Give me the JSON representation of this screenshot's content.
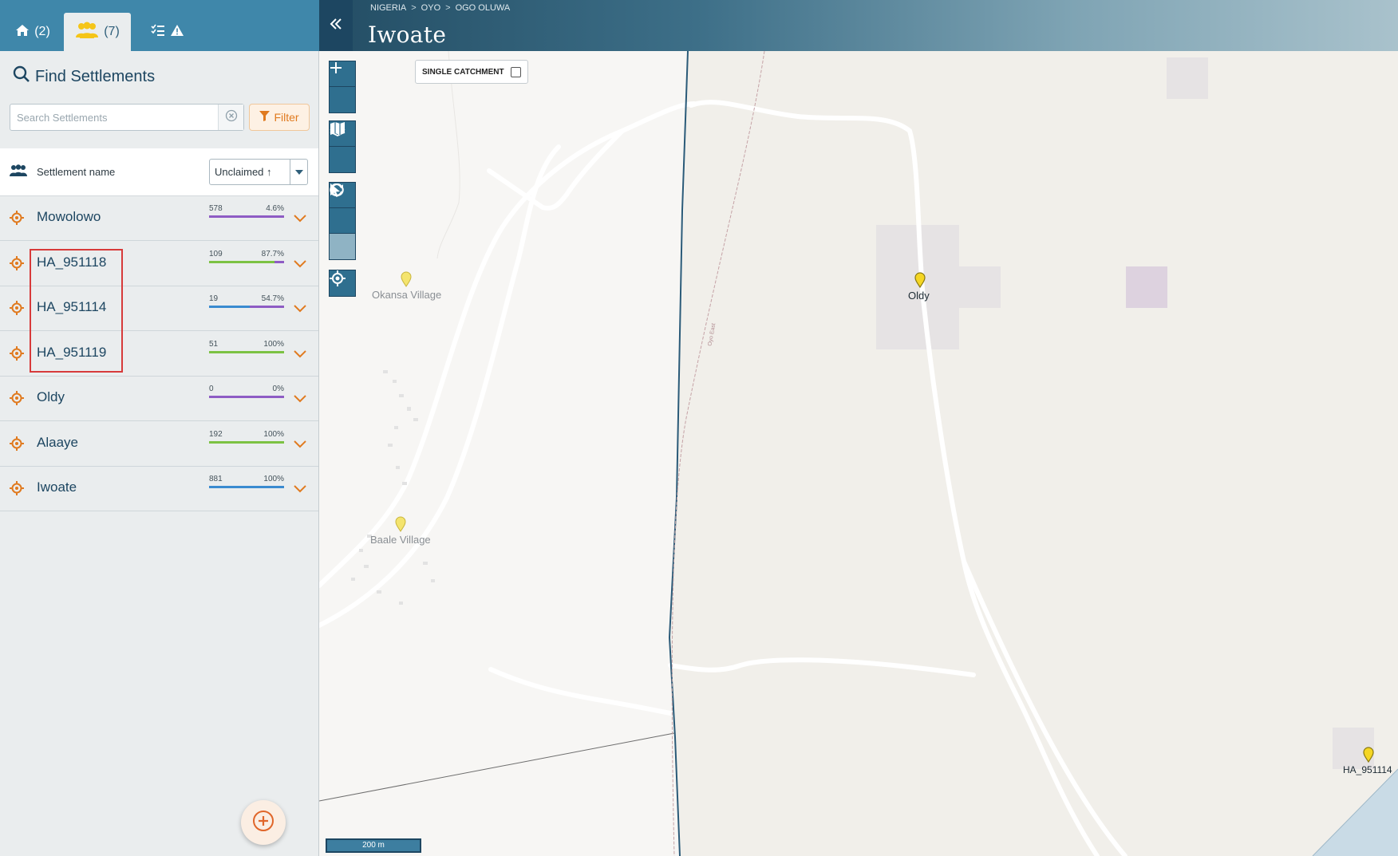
{
  "tabs": {
    "households_count": "(2)",
    "settlements_count": "(7)"
  },
  "finder": {
    "title": "Find Settlements",
    "search_placeholder": "Search Settlements",
    "filter_label": "Filter"
  },
  "list_header": {
    "column_label": "Settlement name",
    "sort_value": "Unclaimed ↑"
  },
  "settlements": [
    {
      "name": "Mowolowo",
      "count": "578",
      "pct": "4.6%",
      "bar_colors": [
        "#8e5cc4"
      ],
      "bar_fracs": [
        1.0
      ]
    },
    {
      "name": "HA_951118",
      "count": "109",
      "pct": "87.7%",
      "bar_colors": [
        "#7cc243",
        "#8e5cc4"
      ],
      "bar_fracs": [
        0.877,
        0.123
      ]
    },
    {
      "name": "HA_951114",
      "count": "19",
      "pct": "54.7%",
      "bar_colors": [
        "#3a8bd0",
        "#8e5cc4"
      ],
      "bar_fracs": [
        0.547,
        0.453
      ]
    },
    {
      "name": "HA_951119",
      "count": "51",
      "pct": "100%",
      "bar_colors": [
        "#7cc243"
      ],
      "bar_fracs": [
        1.0
      ]
    },
    {
      "name": "Oldy",
      "count": "0",
      "pct": "0%",
      "bar_colors": [
        "#8e5cc4"
      ],
      "bar_fracs": [
        1.0
      ]
    },
    {
      "name": "Alaaye",
      "count": "192",
      "pct": "100%",
      "bar_colors": [
        "#7cc243"
      ],
      "bar_fracs": [
        1.0
      ]
    },
    {
      "name": "Iwoate",
      "count": "881",
      "pct": "100%",
      "bar_colors": [
        "#3a8bd0"
      ],
      "bar_fracs": [
        1.0
      ]
    }
  ],
  "header": {
    "breadcrumb": [
      "NIGERIA",
      "OYO",
      "OGO OLUWA"
    ],
    "breadcrumb_sep": ">",
    "title": "Iwoate"
  },
  "map": {
    "single_catchment_label": "SINGLE CATCHMENT",
    "scale_label": "200 m",
    "road_label": "Oyo East",
    "labels": {
      "okansa": "Okansa Village",
      "baale": "Baale Village",
      "oldy": "Oldy",
      "ha951114": "HA_951114"
    }
  },
  "colors": {
    "accent_orange": "#e07a1f",
    "brand_blue": "#1d4661",
    "pin_yellow": "#f5d623"
  }
}
